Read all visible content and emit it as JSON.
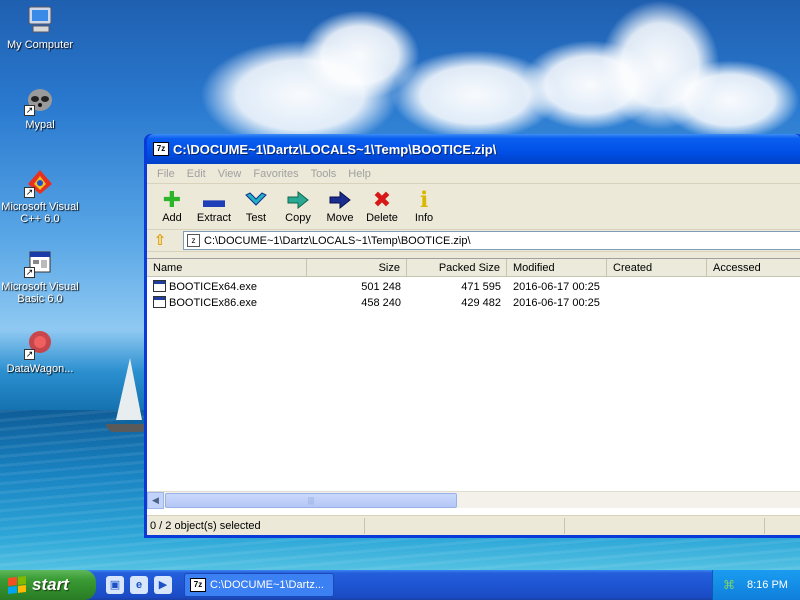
{
  "desktop": {
    "icons": [
      {
        "label": "My Computer"
      },
      {
        "label": "Mypal"
      },
      {
        "label": "Microsoft Visual C++ 6.0"
      },
      {
        "label": "Microsoft Visual Basic 6.0"
      },
      {
        "label": "DataWagon..."
      }
    ]
  },
  "window": {
    "title": "C:\\DOCUME~1\\Dartz\\LOCALS~1\\Temp\\BOOTICE.zip\\",
    "app_icon": "7z",
    "menu": [
      "File",
      "Edit",
      "View",
      "Favorites",
      "Tools",
      "Help"
    ],
    "toolbar": [
      {
        "label": "Add",
        "icon": "plus-icon",
        "glyph": "✚",
        "color": "#2bb52b"
      },
      {
        "label": "Extract",
        "icon": "minus-icon",
        "glyph": "▬",
        "color": "#1f3fb8"
      },
      {
        "label": "Test",
        "icon": "check-chevron-icon",
        "glyph": "⌄",
        "color": "#22b0c8"
      },
      {
        "label": "Copy",
        "icon": "copy-arrow-icon",
        "glyph": "➡",
        "color": "#2a9a8a"
      },
      {
        "label": "Move",
        "icon": "move-arrow-icon",
        "glyph": "➡",
        "color": "#1a2a8a"
      },
      {
        "label": "Delete",
        "icon": "delete-x-icon",
        "glyph": "✖",
        "color": "#d81818"
      },
      {
        "label": "Info",
        "icon": "info-icon",
        "glyph": "ℹ",
        "color": "#d8b800"
      }
    ],
    "address": {
      "path": "C:\\DOCUME~1\\Dartz\\LOCALS~1\\Temp\\BOOTICE.zip\\"
    },
    "columns": [
      "Name",
      "Size",
      "Packed Size",
      "Modified",
      "Created",
      "Accessed"
    ],
    "files": [
      {
        "name": "BOOTICEx64.exe",
        "size": "501 248",
        "packed": "471 595",
        "modified": "2016-06-17 00:25",
        "created": "",
        "accessed": ""
      },
      {
        "name": "BOOTICEx86.exe",
        "size": "458 240",
        "packed": "429 482",
        "modified": "2016-06-17 00:25",
        "created": "",
        "accessed": ""
      }
    ],
    "status": "0 / 2 object(s) selected"
  },
  "taskbar": {
    "start_label": "start",
    "task_label": "C:\\DOCUME~1\\Dartz...",
    "clock": "8:16 PM"
  }
}
